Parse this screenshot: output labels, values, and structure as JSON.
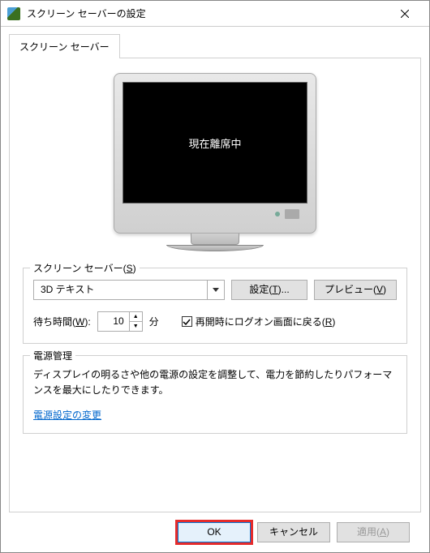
{
  "window": {
    "title": "スクリーン セーバーの設定"
  },
  "tab": {
    "label": "スクリーン セーバー"
  },
  "preview": {
    "screen_text": "現在離席中"
  },
  "screensaver": {
    "group_label": "スクリーン セーバー(",
    "group_accel": "S",
    "group_suffix": ")",
    "selected": "3D テキスト",
    "settings_btn": "設定(",
    "settings_accel": "T",
    "settings_suffix": ")...",
    "preview_btn": "プレビュー(",
    "preview_accel": "V",
    "preview_suffix": ")",
    "wait_label": "待ち時間(",
    "wait_accel": "W",
    "wait_suffix": "):",
    "wait_value": "10",
    "wait_unit": "分",
    "resume_label": "再開時にログオン画面に戻る(",
    "resume_accel": "R",
    "resume_suffix": ")",
    "resume_checked": true
  },
  "power": {
    "group_label": "電源管理",
    "description": "ディスプレイの明るさや他の電源の設定を調整して、電力を節約したりパフォーマンスを最大にしたりできます。",
    "link": "電源設定の変更"
  },
  "buttons": {
    "ok": "OK",
    "cancel": "キャンセル",
    "apply": "適用(",
    "apply_accel": "A",
    "apply_suffix": ")"
  }
}
